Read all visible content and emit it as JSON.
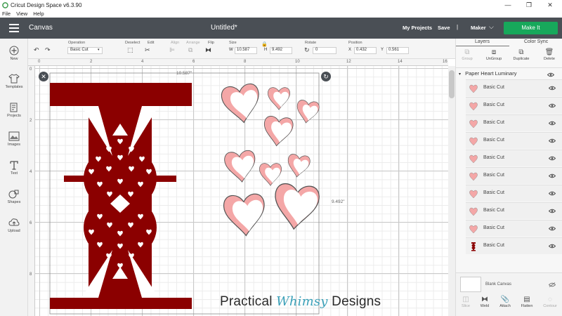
{
  "window": {
    "title": "Cricut Design Space  v6.3.90",
    "controls": [
      "—",
      "❐",
      "✕"
    ]
  },
  "menu": [
    "File",
    "View",
    "Help"
  ],
  "header": {
    "canvas_label": "Canvas",
    "doc_title": "Untitled*",
    "my_projects": "My Projects",
    "save": "Save",
    "separator": "|",
    "machine": "Maker",
    "make_it": "Make It",
    "make_it_color": "#17a85b"
  },
  "left_tools": [
    {
      "label": "New",
      "icon": "plus-icon"
    },
    {
      "label": "Templates",
      "icon": "shirt-icon"
    },
    {
      "label": "Projects",
      "icon": "projects-icon"
    },
    {
      "label": "Images",
      "icon": "image-icon"
    },
    {
      "label": "Text",
      "icon": "text-icon"
    },
    {
      "label": "Shapes",
      "icon": "shapes-icon"
    },
    {
      "label": "Upload",
      "icon": "upload-icon"
    }
  ],
  "edit_bar": {
    "operation_label": "Operation",
    "operation_value": "Basic Cut",
    "deselect_label": "Deselect",
    "edit_label": "Edit",
    "align_label": "Align",
    "arrange_label": "Arrange",
    "flip_label": "Flip",
    "size_label": "Size",
    "w_label": "W",
    "w_value": "10.587",
    "h_label": "H",
    "h_value": "9.492",
    "rotate_label": "Rotate",
    "rotate_value": "0",
    "position_label": "Position",
    "x_label": "X",
    "x_value": "0.432",
    "y_label": "Y",
    "y_value": "0.561"
  },
  "ruler": {
    "top": [
      "0",
      "2",
      "4",
      "6",
      "8",
      "10",
      "12",
      "14",
      "16"
    ],
    "left": [
      "0",
      "2",
      "4",
      "6",
      "8"
    ]
  },
  "canvas": {
    "width_readout": "10.587\"",
    "height_readout": "9.492\"",
    "dark_red": "#8b0000",
    "pink": "#f4a7a7"
  },
  "watermark": {
    "part1": "Practical",
    "part2": "Whimsy",
    "part3": "Designs"
  },
  "panel": {
    "tab_layers": "Layers",
    "tab_color_sync": "Color Sync",
    "actions": [
      {
        "label": "Group",
        "glyph": "⧉",
        "enabled": false
      },
      {
        "label": "UnGroup",
        "glyph": "⧈",
        "enabled": true
      },
      {
        "label": "Duplicate",
        "glyph": "⧉",
        "enabled": true
      },
      {
        "label": "Delete",
        "glyph": "🗑",
        "enabled": true
      }
    ],
    "group_name": "Paper Heart Luminary",
    "layers": [
      {
        "name": "Basic Cut",
        "thumb": "pink-heart"
      },
      {
        "name": "Basic Cut",
        "thumb": "pink-heart"
      },
      {
        "name": "Basic Cut",
        "thumb": "pink-heart"
      },
      {
        "name": "Basic Cut",
        "thumb": "pink-heart"
      },
      {
        "name": "Basic Cut",
        "thumb": "pink-heart"
      },
      {
        "name": "Basic Cut",
        "thumb": "pink-heart"
      },
      {
        "name": "Basic Cut",
        "thumb": "pink-heart"
      },
      {
        "name": "Basic Cut",
        "thumb": "pink-heart"
      },
      {
        "name": "Basic Cut",
        "thumb": "pink-heart"
      },
      {
        "name": "Basic Cut",
        "thumb": "red-luminary"
      }
    ],
    "blank_canvas": "Blank Canvas",
    "bottom_actions": [
      {
        "label": "Slice",
        "glyph": "◫",
        "enabled": false
      },
      {
        "label": "Weld",
        "glyph": "⧓",
        "enabled": true
      },
      {
        "label": "Attach",
        "glyph": "📎",
        "enabled": true
      },
      {
        "label": "Flatten",
        "glyph": "▤",
        "enabled": true
      },
      {
        "label": "Contour",
        "glyph": "◌",
        "enabled": false
      }
    ]
  }
}
